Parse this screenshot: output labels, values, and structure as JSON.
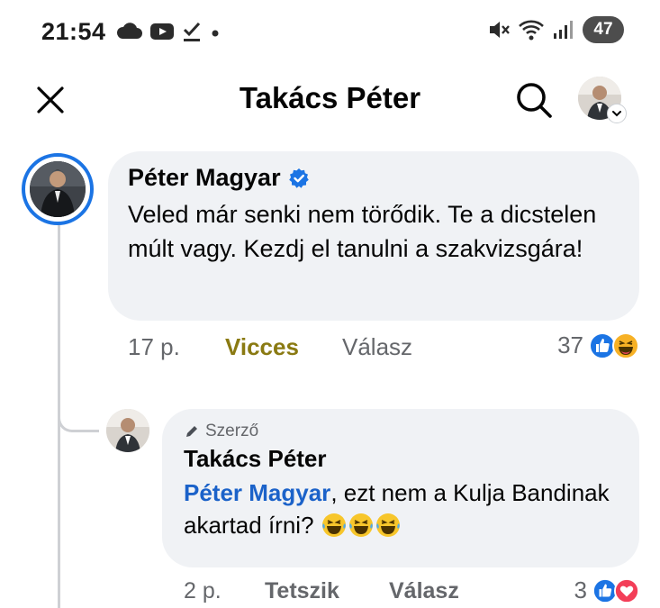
{
  "status_bar": {
    "time": "21:54",
    "battery": "47",
    "left_icons": [
      "cloud-icon",
      "youtube-icon",
      "check-download-icon",
      "dot-icon"
    ],
    "right_icons": [
      "mute-icon",
      "wifi-icon",
      "signal-icon",
      "battery-icon"
    ]
  },
  "header": {
    "title": "Takács Péter",
    "icons": [
      "close-icon",
      "search-icon",
      "chevron-down-icon"
    ]
  },
  "comments": [
    {
      "author": "Péter Magyar",
      "verified": true,
      "text": "Veled már senki nem törődik. Te a dicstelen múlt vagy. Kezdj el tanulni a szakvizsgára!",
      "time": "17 p.",
      "reaction_action": "Vicces",
      "reply_action": "Válasz",
      "reaction_count": "37",
      "reactions": [
        "like",
        "haha"
      ]
    },
    {
      "badge": "Szerző",
      "author": "Takács Péter",
      "mention": "Péter Magyar",
      "text": ", ezt nem a Kulja Bandinak akartad írni?",
      "text_emojis": [
        "haha-emoji",
        "haha-emoji",
        "haha-emoji"
      ],
      "time": "2 p.",
      "reaction_action": "Tetszik",
      "reply_action": "Válasz",
      "reaction_count": "3",
      "reactions": [
        "like",
        "love"
      ]
    }
  ],
  "colors": {
    "accent_blue": "#1b74e4",
    "mention_blue": "#1b62c9",
    "bubble_bg": "#f0f2f5",
    "funny_text": "#8a7a12",
    "meta_gray": "#65676b",
    "love_red": "#f33e58"
  }
}
